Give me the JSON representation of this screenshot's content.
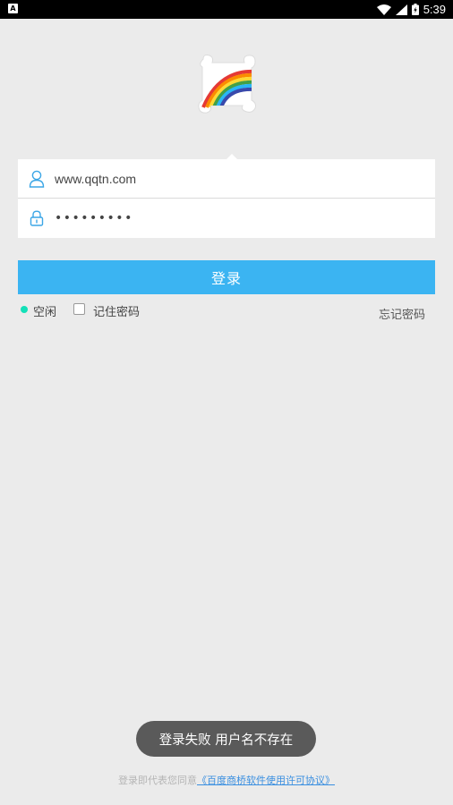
{
  "status_bar": {
    "notification_icon": "A",
    "time": "5:39",
    "icons": [
      "wifi-icon",
      "signal-icon",
      "battery-icon"
    ]
  },
  "logo": {
    "icon": "rainbow-cloud-logo"
  },
  "login": {
    "username_value": "www.qqtn.com",
    "password_mask": "•••••••••",
    "login_button": "登录",
    "status_label": "空闲",
    "remember_label": "记住密码",
    "forgot_label": "忘记密码",
    "remember_checked": false
  },
  "toast": {
    "message": "登录失败 用户名不存在"
  },
  "footer": {
    "prefix": "登录即代表您同意",
    "agreement_link": "《百度商桥软件使用许可协议》"
  },
  "colors": {
    "accent": "#3bb4f2",
    "status_online": "#13e0b8",
    "link": "#3a8fe0",
    "background": "#ebebeb"
  }
}
